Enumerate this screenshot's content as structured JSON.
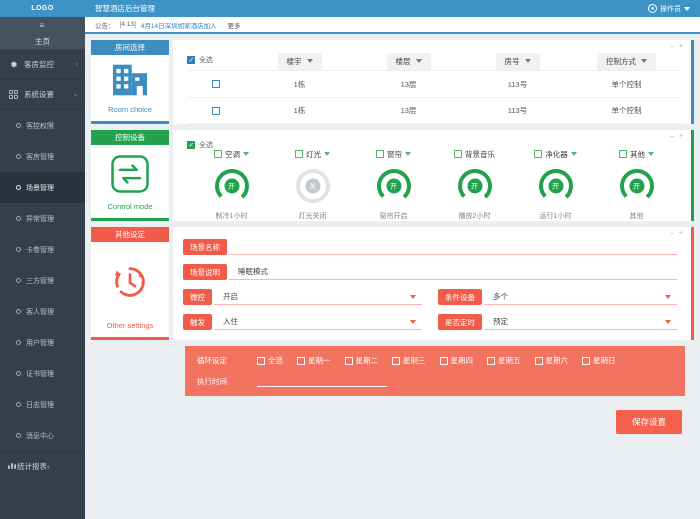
{
  "sidebar": {
    "logo": "LOGO",
    "menu_icon": "≡",
    "home_label": "主页",
    "groups": [
      {
        "label": "客房监控",
        "icon": "gear-icon",
        "arrow": "‹"
      },
      {
        "label": "系统设置",
        "icon": "grid-icon",
        "arrow": "⌄"
      }
    ],
    "items": [
      {
        "label": "客控权限"
      },
      {
        "label": "客房管理"
      },
      {
        "label": "场景管理"
      },
      {
        "label": "异常管理"
      },
      {
        "label": "卡卷管理"
      },
      {
        "label": "三方管理"
      },
      {
        "label": "客人管理"
      },
      {
        "label": "用户管理"
      },
      {
        "label": "证书管理"
      },
      {
        "label": "日志管理"
      },
      {
        "label": "消息中心"
      }
    ],
    "bottom": {
      "label": "统计报表",
      "icon": "bar-chart-icon",
      "arrow": "‹"
    }
  },
  "topbar": {
    "title": "智慧酒店后台管理",
    "user": "操作员"
  },
  "notice": {
    "label": "公告：",
    "date": "[4.13]",
    "text": "4月14日深圳如家酒店加入",
    "more": "更多"
  },
  "panels": {
    "room": {
      "tab": "房间选择",
      "en": "Room choice",
      "icon": "building-icon",
      "accent": "#3d8dbe",
      "minimize": "–",
      "maximize": "+",
      "select_all": "全选",
      "columns": [
        "楼宇",
        "楼层",
        "房号",
        "控制方式"
      ],
      "rows": [
        {
          "building": "1栋",
          "floor": "13层",
          "room": "113号",
          "mode": "单个控制"
        },
        {
          "building": "1栋",
          "floor": "13层",
          "room": "113号",
          "mode": "单个控制"
        }
      ]
    },
    "control": {
      "tab": "控制设备",
      "en": "Control mode",
      "icon": "exchange-icon",
      "accent": "#23a24d",
      "minimize": "–",
      "maximize": "+",
      "select_all": "全选",
      "devices": [
        {
          "name": "空调",
          "state": "开",
          "on": true,
          "sub": "制冷1小时",
          "has_dropdown": true
        },
        {
          "name": "灯光",
          "state": "关",
          "on": false,
          "sub": "灯光关闭",
          "has_dropdown": true
        },
        {
          "name": "窗帘",
          "state": "开",
          "on": true,
          "sub": "窗帘开启",
          "has_dropdown": true
        },
        {
          "name": "背景音乐",
          "state": "开",
          "on": true,
          "sub": "播放2小时",
          "has_dropdown": false
        },
        {
          "name": "净化器",
          "state": "开",
          "on": true,
          "sub": "运行1小时",
          "has_dropdown": true
        },
        {
          "name": "其他",
          "state": "开",
          "on": true,
          "sub": "其他",
          "has_dropdown": true
        }
      ]
    },
    "other": {
      "tab": "其他设定",
      "en": "Other settings",
      "icon": "clock-icon",
      "accent": "#f15b4a",
      "minimize": "–",
      "maximize": "+",
      "fields": {
        "scene_name_label": "场景名称",
        "scene_name_value": "",
        "scene_desc_label": "场景说明",
        "scene_desc_value": "睡眠模式",
        "micro_label": "微控",
        "micro_value": "开启",
        "cond_label": "条件设备",
        "cond_value": "多个",
        "trigger_label": "触发",
        "trigger_value": "入住",
        "timing_label": "是否定时",
        "timing_value": "预定"
      },
      "cycle": {
        "label": "循环设定",
        "all": "全选",
        "days": [
          "星期一",
          "星期二",
          "星期三",
          "星期四",
          "星期五",
          "星期六",
          "星期日"
        ],
        "exec_label": "执行时间",
        "exec_value": ""
      }
    }
  },
  "footer": {
    "save": "保存设置"
  }
}
